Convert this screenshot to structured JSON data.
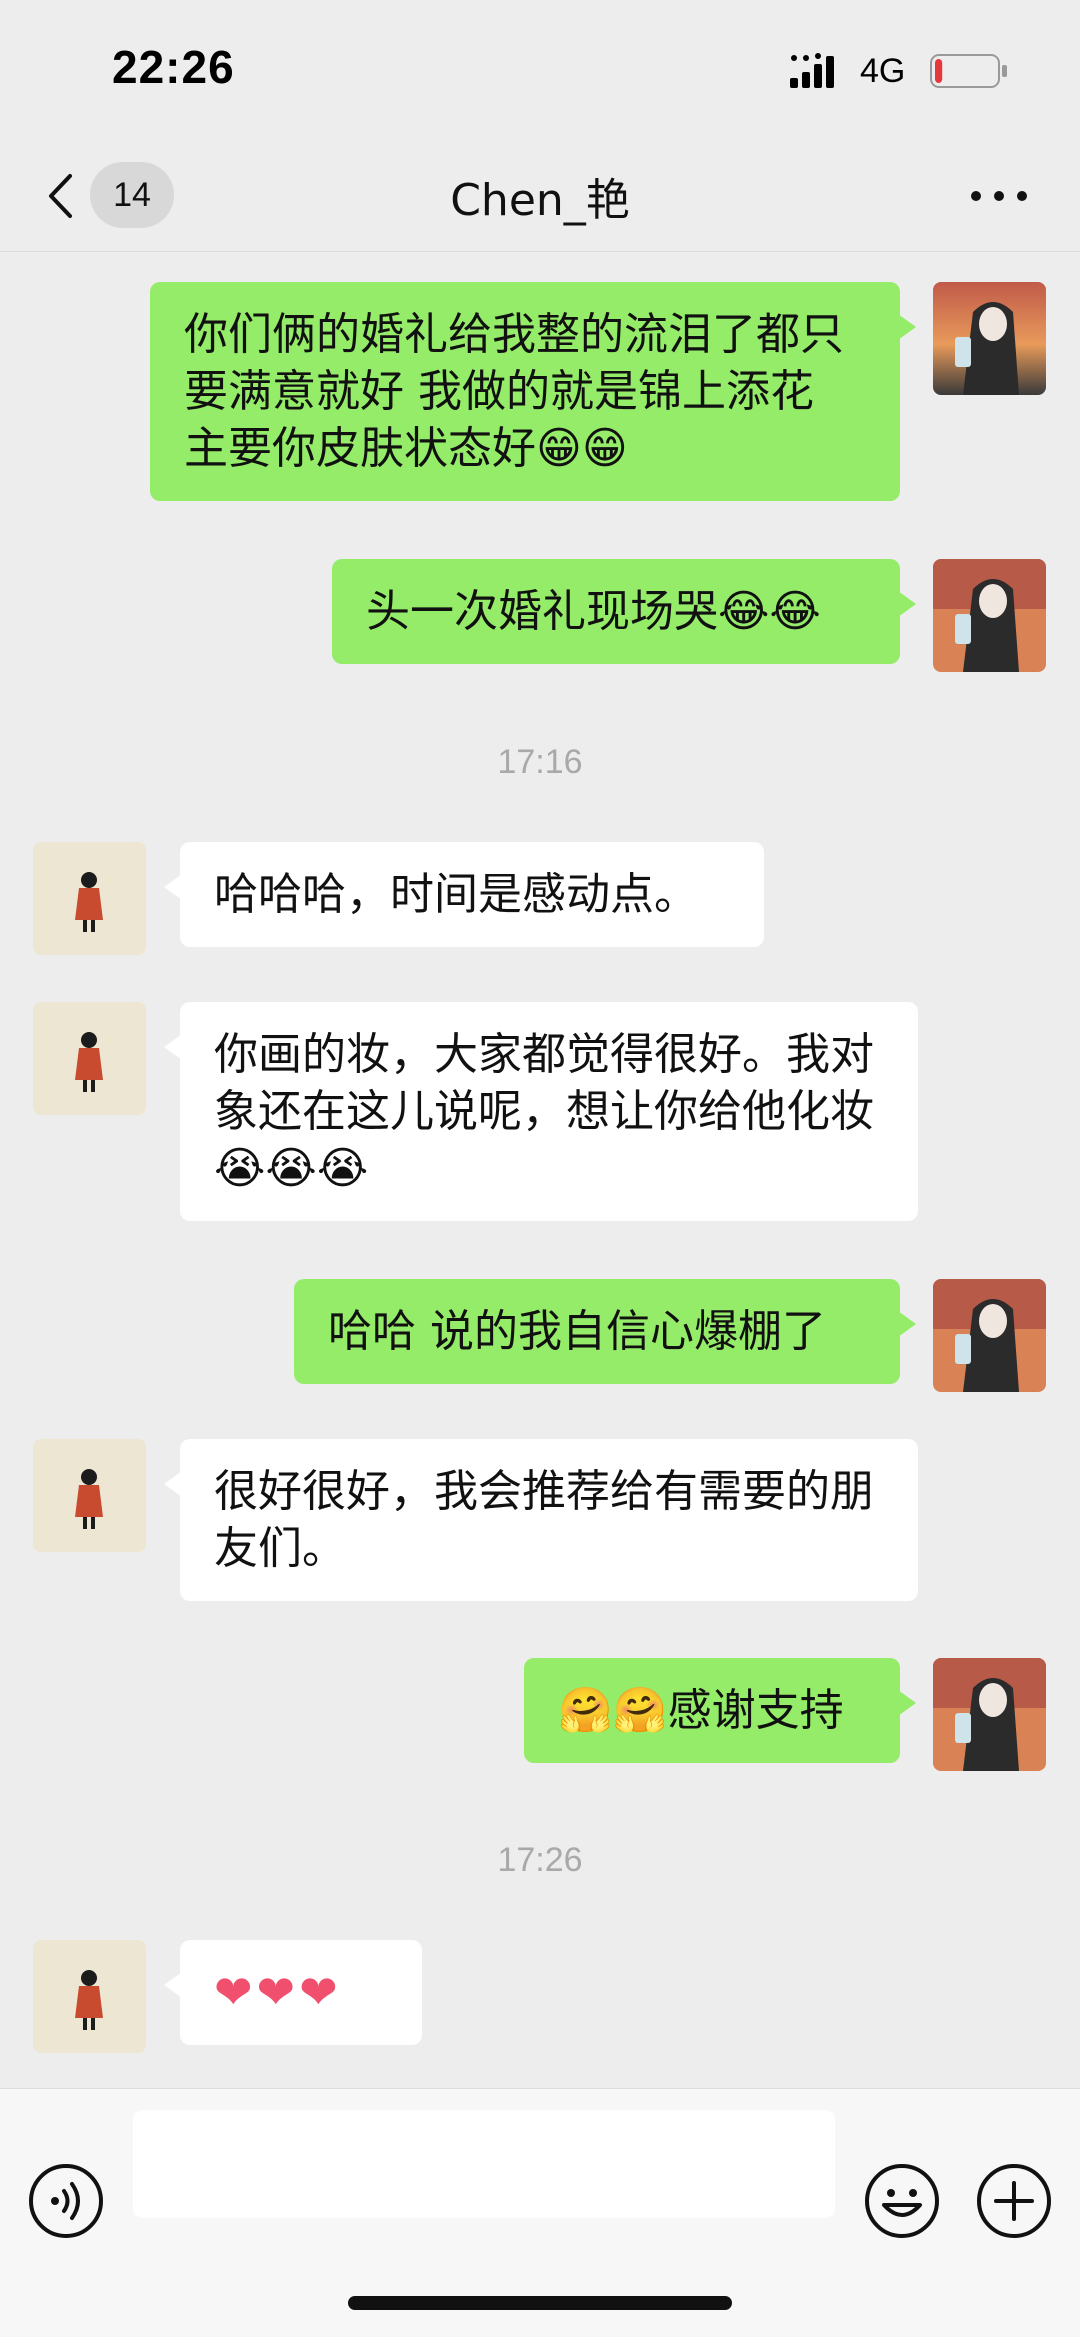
{
  "status_bar": {
    "time": "22:26",
    "network": "4G",
    "battery_level": 0.12,
    "battery_color": "#e5383b"
  },
  "header": {
    "back_icon": "chevron-left-icon",
    "unread_count": "14",
    "title": "Chen_艳",
    "more_icon": "more-dots-icon"
  },
  "messages": [
    {
      "side": "sent",
      "text": "你们俩的婚礼给我整的流泪了都只要满意就好 我做的就是锦上添花 主要你皮肤状态好😁😁"
    },
    {
      "side": "sent",
      "text": "头一次婚礼现场哭😂😂"
    },
    {
      "type": "timestamp",
      "text": "17:16"
    },
    {
      "side": "received",
      "text": "哈哈哈，时间是感动点。"
    },
    {
      "side": "received",
      "text": "你画的妆，大家都觉得很好。我对象还在这儿说呢，想让你给他化妆😭😭😭"
    },
    {
      "side": "sent",
      "text": "哈哈 说的我自信心爆棚了"
    },
    {
      "side": "received",
      "text": "很好很好，我会推荐给有需要的朋友们。"
    },
    {
      "side": "sent",
      "text": "🤗🤗感谢支持"
    },
    {
      "type": "timestamp",
      "text": "17:26"
    },
    {
      "side": "received",
      "text": "❤❤❤"
    }
  ],
  "input_bar": {
    "voice_icon": "voice-icon",
    "input_value": "",
    "emoji_icon": "emoji-icon",
    "plus_icon": "plus-icon"
  },
  "colors": {
    "sent_bubble": "#95ec69",
    "received_bubble": "#ffffff",
    "background": "#ededed",
    "timestamp": "#a9a9a9"
  }
}
